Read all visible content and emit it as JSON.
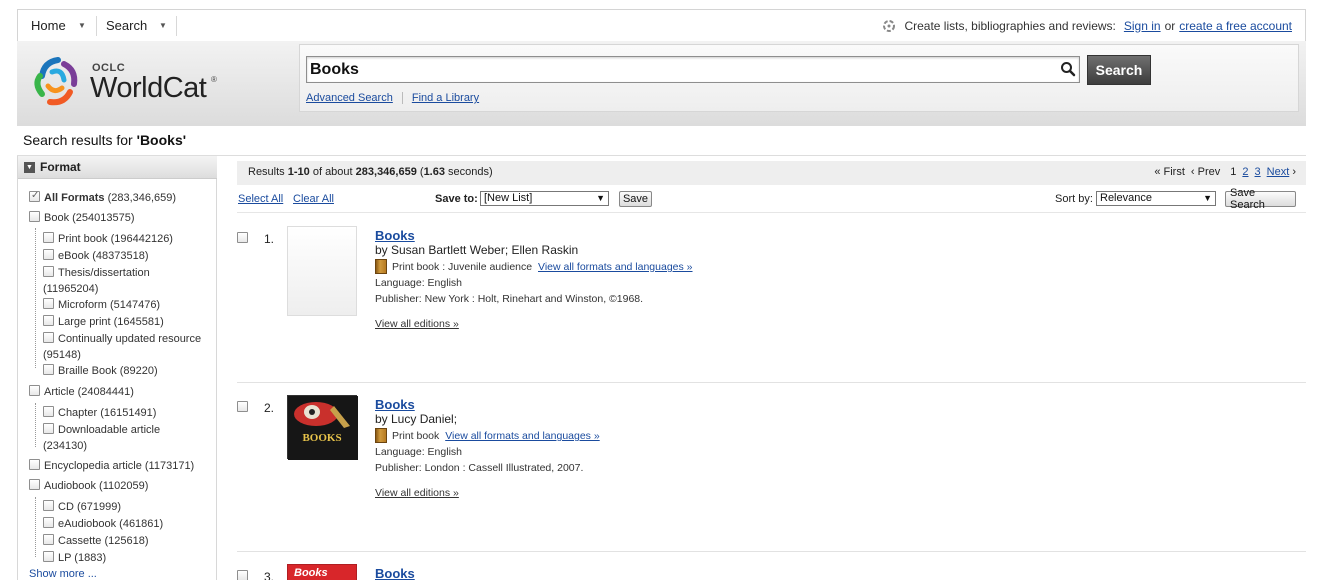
{
  "nav": {
    "home": "Home",
    "search": "Search",
    "promo_text": "Create lists, bibliographies and reviews:",
    "sign_in": "Sign in",
    "or": "or",
    "create_account": "create a free account"
  },
  "logo": {
    "oclc": "OCLC",
    "name": "WorldCat",
    "reg": "®"
  },
  "search": {
    "query": "Books",
    "button": "Search",
    "advanced": "Advanced Search",
    "find_library": "Find a Library"
  },
  "results_for": {
    "prefix": "Search results for ",
    "query": "'Books'"
  },
  "sidebar": {
    "heading": "Format",
    "items": [
      {
        "label": "All Formats",
        "count": "(283,346,659)"
      },
      {
        "label": "Book (254013575)"
      },
      {
        "label": "Print book (196442126)"
      },
      {
        "label": "eBook (48373518)"
      },
      {
        "label": "Thesis/dissertation",
        "label2": "(11965204)"
      },
      {
        "label": "Microform (5147476)"
      },
      {
        "label": "Large print (1645581)"
      },
      {
        "label": "Continually updated resource",
        "label2": "(95148)"
      },
      {
        "label": "Braille Book (89220)"
      },
      {
        "label": "Article (24084441)"
      },
      {
        "label": "Chapter (16151491)"
      },
      {
        "label": "Downloadable article",
        "label2": "(234130)"
      },
      {
        "label": "Encyclopedia article (1173171)"
      },
      {
        "label": "Audiobook (1102059)"
      },
      {
        "label": "CD (671999)"
      },
      {
        "label": "eAudiobook (461861)"
      },
      {
        "label": "Cassette (125618)"
      },
      {
        "label": "LP (1883)"
      }
    ],
    "show_more": "Show more ..."
  },
  "results_bar": {
    "prefix": "Results ",
    "range": "1-10",
    "mid": " of about ",
    "total": "283,346,659",
    "open": " (",
    "time": "1.63",
    "close": " seconds)"
  },
  "pager": {
    "first": "First",
    "prev": "Prev",
    "current": "1",
    "p2": "2",
    "p3": "3",
    "next": "Next"
  },
  "toolbar": {
    "select_all": "Select All",
    "clear_all": "Clear All",
    "save_to_label": "Save to:",
    "save_to_value": "[New List]",
    "save": "Save",
    "sort_label": "Sort by:",
    "sort_value": "Relevance",
    "save_search": "Save Search"
  },
  "results": [
    {
      "num": "1.",
      "title": "Books",
      "by": "by Susan Bartlett Weber; Ellen Raskin",
      "format": "Print book : Juvenile audience",
      "formats_link": "View all formats and languages »",
      "language": "Language: English",
      "publisher": "Publisher: New York : Holt, Rinehart and Winston, ©1968.",
      "editions": "View all editions »"
    },
    {
      "num": "2.",
      "title": "Books",
      "by": "by Lucy Daniel;",
      "format": "Print book",
      "formats_link": "View all formats and languages »",
      "language": "Language: English",
      "publisher": "Publisher: London : Cassell Illustrated, 2007.",
      "editions": "View all editions »",
      "cover_text": "BOOKS"
    },
    {
      "num": "3.",
      "title": "Books",
      "cover_text": "Books"
    }
  ],
  "colors": {
    "link": "#1a4b9e",
    "search_button": "#4a4a4a",
    "header_bg": "#e6e6e6"
  }
}
